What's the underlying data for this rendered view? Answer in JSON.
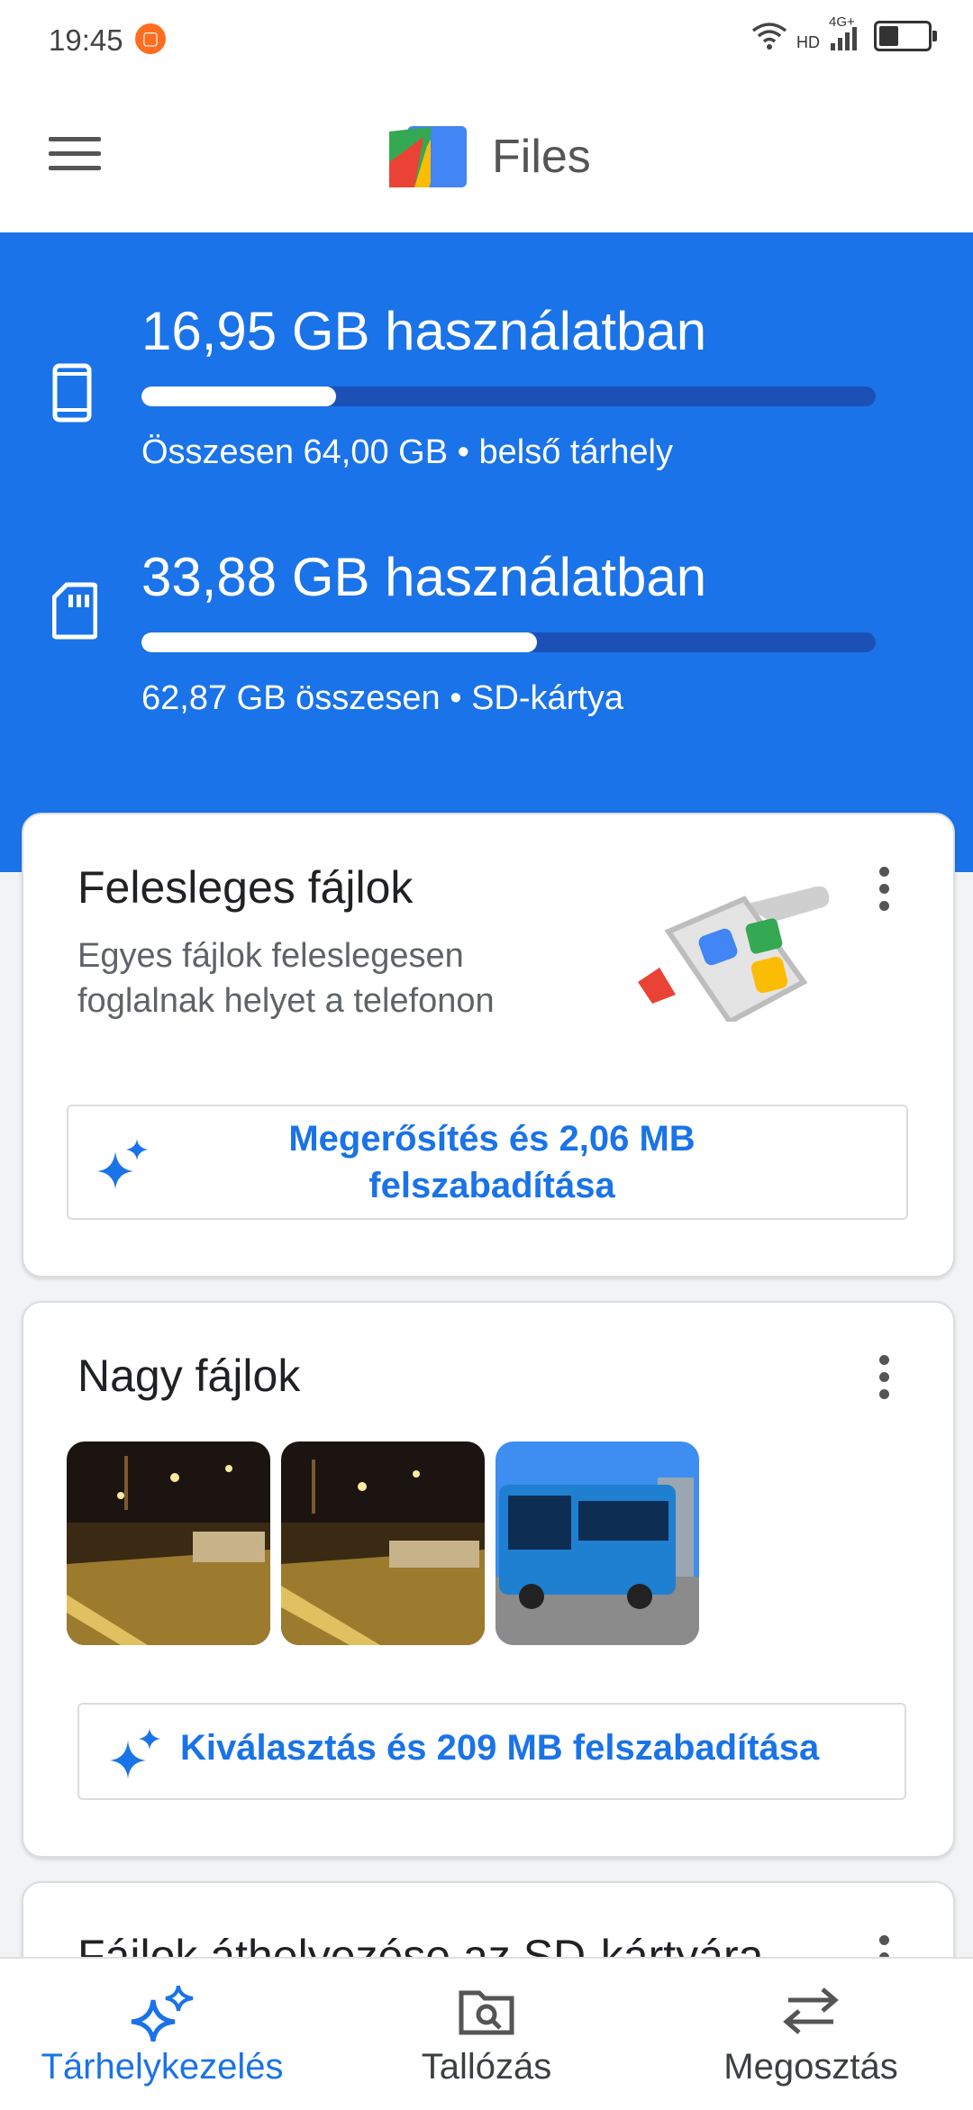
{
  "status": {
    "time": "19:45",
    "network_label": "4G+",
    "hd_label": "HD",
    "battery_level": 0.45
  },
  "app": {
    "title": "Files"
  },
  "storage": [
    {
      "used_label": "16,95 GB használatban",
      "sub_label": "Összesen 64,00 GB • belső tárhely",
      "used_fraction": 0.265,
      "icon": "phone-icon"
    },
    {
      "used_label": "33,88 GB használatban",
      "sub_label": "62,87 GB összesen • SD-kártya",
      "used_fraction": 0.539,
      "icon": "sd-card-icon"
    }
  ],
  "junk_card": {
    "title": "Felesleges fájlok",
    "description": "Egyes fájlok feleslegesen foglalnak helyet a telefonon",
    "button_label": "Megerősítés és 2,06 MB felszabadítása"
  },
  "large_files_card": {
    "title": "Nagy fájlok",
    "thumbnails": [
      "night-square-photo",
      "night-square-photo-2",
      "blue-bus-photo"
    ],
    "button_label": "Kiválasztás és 209 MB felszabadítása"
  },
  "sd_card": {
    "title": "Fájlok áthelyezése az SD-kártyára"
  },
  "bottom_nav": [
    {
      "label": "Tárhelykezelés",
      "active": true
    },
    {
      "label": "Tallózás",
      "active": false
    },
    {
      "label": "Megosztás",
      "active": false
    }
  ],
  "colors": {
    "accent": "#1a73e8",
    "bar_track": "#1b51b7",
    "background": "#f1f3f4"
  }
}
